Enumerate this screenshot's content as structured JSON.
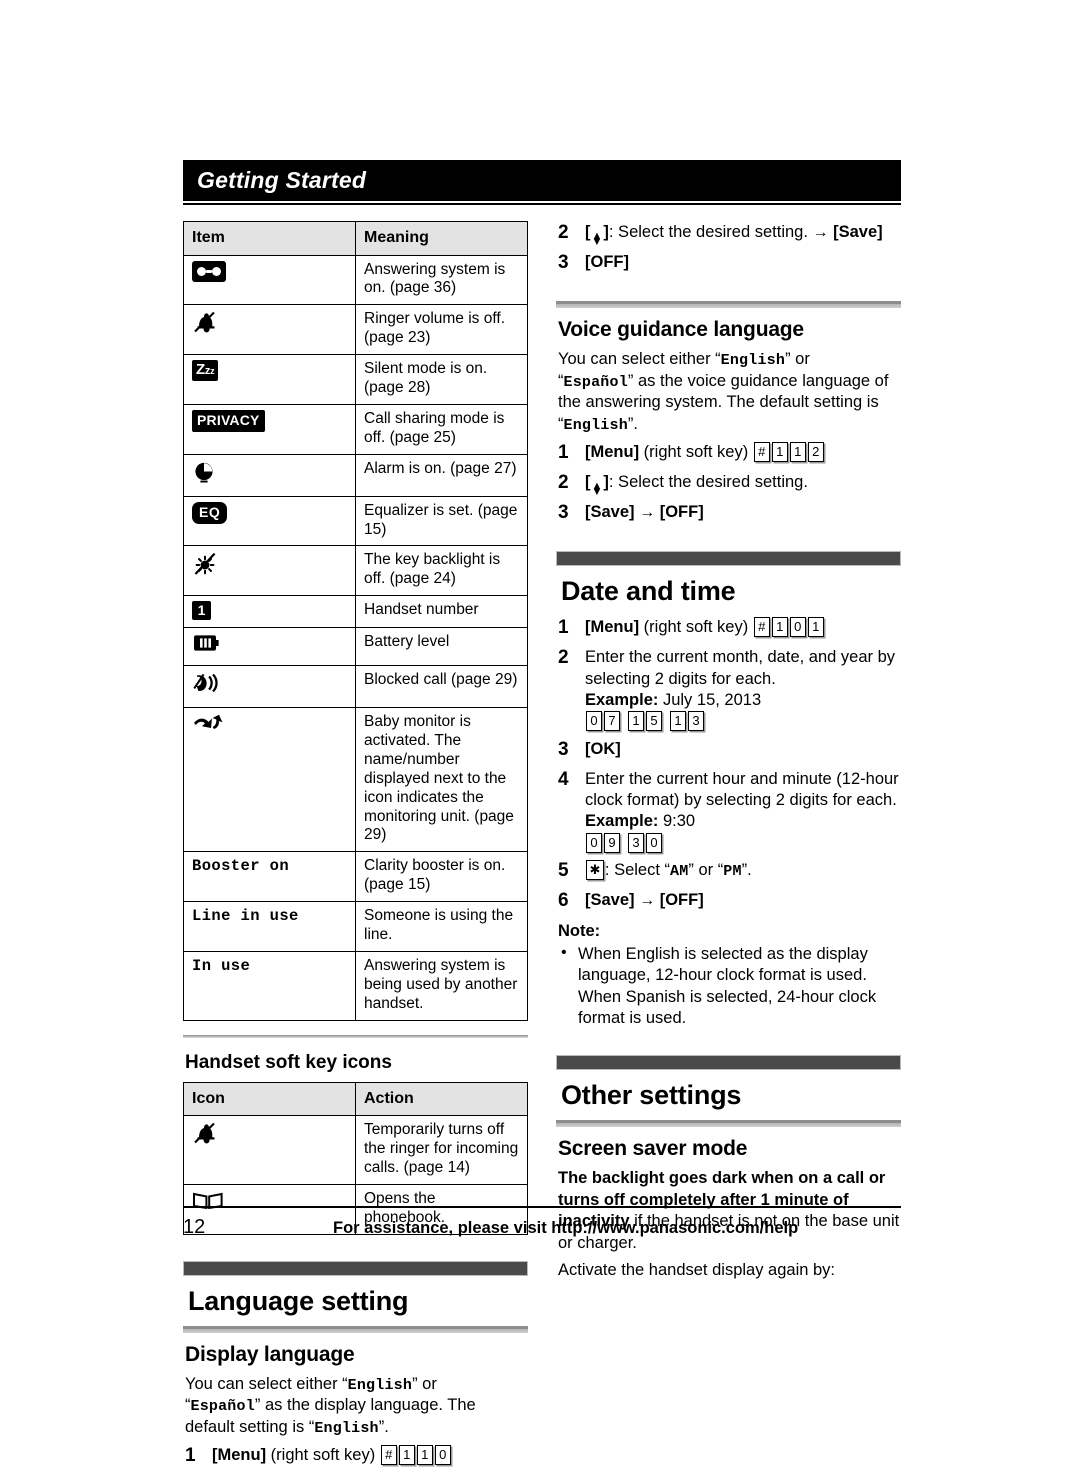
{
  "chapter": {
    "title": "Getting Started"
  },
  "footer": {
    "page_number": "12",
    "assistance": "For assistance, please visit http://www.panasonic.com/help"
  },
  "display_icons_table": {
    "headers": {
      "item": "Item",
      "meaning": "Meaning"
    },
    "rows": [
      {
        "icon": "answering-system-icon",
        "icon_text": "",
        "meaning": "Answering system is on. (page 36)"
      },
      {
        "icon": "ringer-off-icon",
        "icon_text": "",
        "meaning": "Ringer volume is off. (page 23)"
      },
      {
        "icon": "silent-mode-icon",
        "icon_text": "Zzz",
        "meaning": "Silent mode is on. (page 28)"
      },
      {
        "icon": "privacy-icon",
        "icon_text": "PRIVACY",
        "meaning": "Call sharing mode is off. (page 25)"
      },
      {
        "icon": "alarm-clock-icon",
        "icon_text": "",
        "meaning": "Alarm is on. (page 27)"
      },
      {
        "icon": "equalizer-icon",
        "icon_text": "EQ",
        "meaning": "Equalizer is set. (page 15)"
      },
      {
        "icon": "key-backlight-off-icon",
        "icon_text": "",
        "meaning": "The key backlight is off. (page 24)"
      },
      {
        "icon": "handset-number-icon",
        "icon_text": "1",
        "meaning": "Handset number"
      },
      {
        "icon": "battery-level-icon",
        "icon_text": "",
        "meaning": "Battery level"
      },
      {
        "icon": "blocked-call-icon",
        "icon_text": "",
        "meaning": "Blocked call (page 29)"
      },
      {
        "icon": "baby-monitor-icon",
        "icon_text": "",
        "meaning": "Baby monitor is activated. The name/number displayed next to the icon indicates the monitoring unit. (page 29)"
      },
      {
        "icon": "text-booster-on",
        "icon_text": "Booster on",
        "meaning": "Clarity booster is on. (page 15)"
      },
      {
        "icon": "text-line-in-use",
        "icon_text": "Line in use",
        "meaning": "Someone is using the line."
      },
      {
        "icon": "text-in-use",
        "icon_text": "In use",
        "meaning": "Answering system is being used by another handset."
      }
    ]
  },
  "soft_key_section": {
    "heading": "Handset soft key icons",
    "headers": {
      "icon": "Icon",
      "action": "Action"
    },
    "rows": [
      {
        "icon": "ringer-off-icon",
        "action": "Temporarily turns off the ringer for incoming calls. (page 14)"
      },
      {
        "icon": "phonebook-icon",
        "action": "Opens the phonebook."
      }
    ]
  },
  "display_language_tail": {
    "step2": {
      "num": "2",
      "prefix": "",
      "text": ": Select the desired setting.",
      "arrow": "→",
      "softkey": "[Save]"
    },
    "step3": {
      "num": "3",
      "softkey": "[OFF]"
    }
  },
  "voice_guidance": {
    "heading": "Voice guidance language",
    "body_1": "You can select either “",
    "opt_english": "English",
    "body_2": "” or",
    "body_3": "“",
    "opt_espanol": "Español",
    "body_4": "” as the voice guidance language of the answering system. The default setting is",
    "body_5": "“",
    "default_val": "English",
    "body_6": "”.",
    "step1": {
      "num": "1",
      "menu": "[Menu]",
      "hint": "(right soft key)",
      "keys": [
        "#",
        "1",
        "1",
        "2"
      ]
    },
    "step2": {
      "num": "2",
      "text": ": Select the desired setting."
    },
    "step3": {
      "num": "3",
      "save": "[Save]",
      "arrow": "→",
      "off": "[OFF]"
    }
  },
  "date_and_time": {
    "heading": "Date and time",
    "step1": {
      "num": "1",
      "menu": "[Menu]",
      "hint": "(right soft key)",
      "keys": [
        "#",
        "1",
        "0",
        "1"
      ]
    },
    "step2": {
      "num": "2",
      "text": "Enter the current month, date, and year by selecting 2 digits for each.",
      "example_label": "Example:",
      "example_value": "July 15, 2013",
      "keys": [
        "0",
        "7",
        "1",
        "5",
        "1",
        "3"
      ]
    },
    "step3": {
      "num": "3",
      "softkey": "[OK]"
    },
    "step4": {
      "num": "4",
      "text": "Enter the current hour and minute (12-hour clock format) by selecting 2 digits for each.",
      "example_label": "Example:",
      "example_value": "9:30",
      "keys": [
        "0",
        "9",
        "3",
        "0"
      ]
    },
    "step5": {
      "num": "5",
      "star": "✳",
      "text_a": ": Select “",
      "am": "AM",
      "text_b": "” or “",
      "pm": "PM",
      "text_c": "”."
    },
    "step6": {
      "num": "6",
      "save": "[Save]",
      "arrow": "→",
      "off": "[OFF]"
    },
    "note_heading": "Note:",
    "notes": [
      "When English is selected as the display language, 12-hour clock format is used. When Spanish is selected, 24-hour clock format is used."
    ]
  },
  "language_setting": {
    "heading": "Language setting",
    "display_language": {
      "heading": "Display language",
      "body_1": "You can select either “",
      "opt_english": "English",
      "body_2": "” or",
      "body_3": "“",
      "opt_espanol": "Español",
      "body_4": "” as the display language. The default setting is “",
      "default_val": "English",
      "body_5": "”.",
      "step1": {
        "num": "1",
        "menu": "[Menu]",
        "hint": "(right soft key)",
        "keys": [
          "#",
          "1",
          "1",
          "0"
        ]
      }
    }
  },
  "other_settings": {
    "heading": "Other settings",
    "screen_saver": {
      "heading": "Screen saver mode",
      "bold_text": "The backlight goes dark when on a call or turns off completely after 1 minute of inactivity",
      "rest_text": " if the handset is not on the base unit or charger.",
      "tail_text": "Activate the handset display again by:"
    }
  },
  "colors": {
    "chapter_bar": "#000000",
    "section_bar": "#4a4a4a",
    "table_header": "#e3e3e3",
    "sub_rule": "#8d8d8d"
  }
}
